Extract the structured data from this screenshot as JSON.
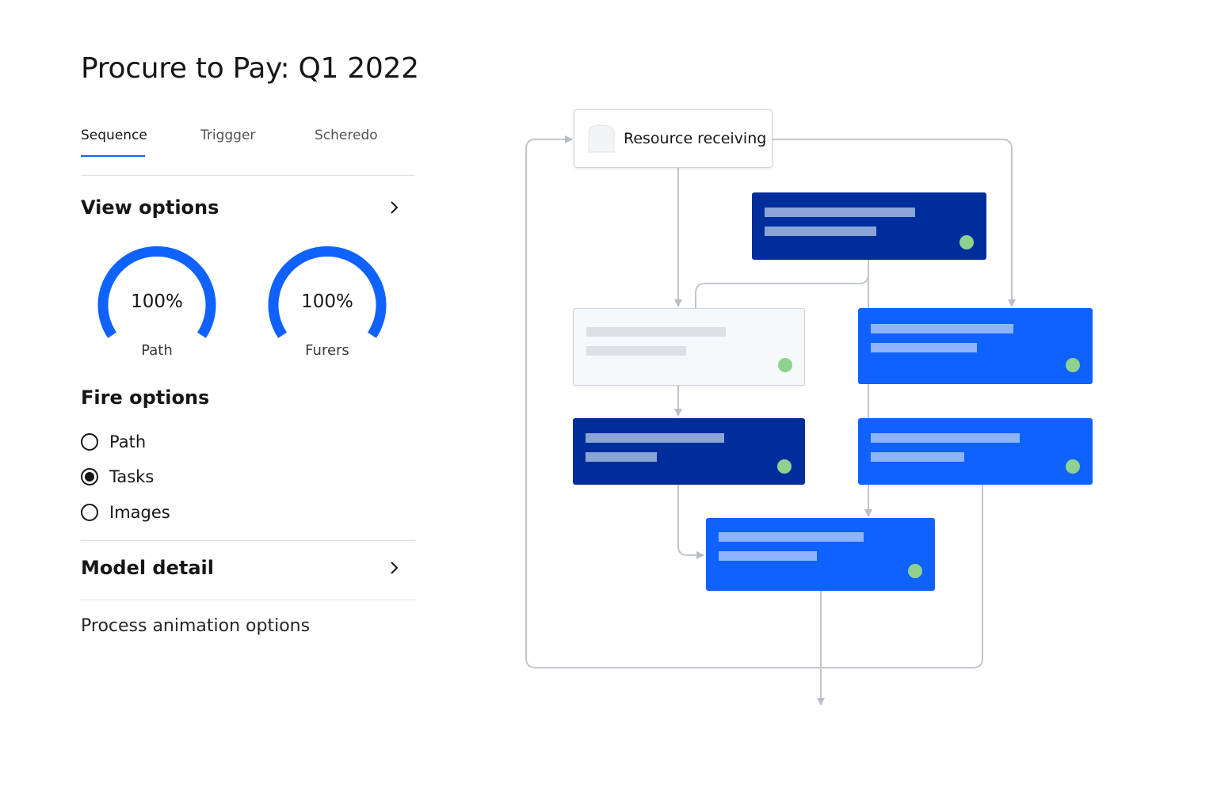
{
  "page": {
    "title": "Procure to Pay: Q1 2022"
  },
  "tabs": [
    {
      "label": "Sequence",
      "active": true
    },
    {
      "label": "Triggger",
      "active": false
    },
    {
      "label": "Scheredo",
      "active": false
    }
  ],
  "view_options": {
    "title": "View options",
    "chevron_icon": "chevron-right-icon",
    "gauges": [
      {
        "value_label": "100%",
        "value": 1.0,
        "label": "Path"
      },
      {
        "value_label": "100%",
        "value": 1.0,
        "label": "Furers"
      }
    ]
  },
  "fire_options": {
    "title": "Fire options",
    "options": [
      {
        "label": "Path",
        "selected": false
      },
      {
        "label": "Tasks",
        "selected": true
      },
      {
        "label": "Images",
        "selected": false
      }
    ]
  },
  "model_detail": {
    "title": "Model detail",
    "chevron_icon": "chevron-right-icon"
  },
  "process_animation": {
    "label": "Process animation options"
  },
  "diagram": {
    "start_node": {
      "label": "Resource receiving",
      "icon": "document-icon"
    },
    "colors": {
      "dark_node": "#002d9c",
      "blue_node": "#0f62fe",
      "light_node": "#f6f9fb",
      "status_ok": "#8fd28f",
      "connector": "#c1c7cd",
      "accent": "#0f62fe"
    }
  }
}
